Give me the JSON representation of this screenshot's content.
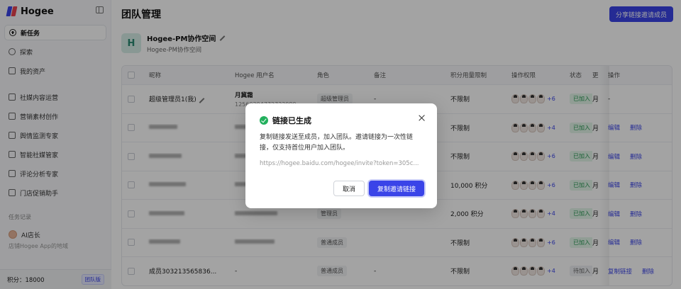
{
  "brand": "Hogee",
  "sidebar": {
    "items": [
      {
        "label": "新任务",
        "icon": "plus-circle-icon"
      },
      {
        "label": "探索",
        "icon": "compass-icon"
      },
      {
        "label": "我的资产",
        "icon": "folder-icon"
      },
      {
        "label": "社媒内容运营",
        "icon": "document-icon"
      },
      {
        "label": "营销素材创作",
        "icon": "image-icon"
      },
      {
        "label": "舆情监测专家",
        "icon": "monitor-icon"
      },
      {
        "label": "智能社媒管家",
        "icon": "document-icon"
      },
      {
        "label": "评论分析专家",
        "icon": "chat-icon"
      },
      {
        "label": "门店促销助手",
        "icon": "megaphone-icon"
      }
    ],
    "history_label": "任务记录",
    "history": [
      {
        "label": "AI店长"
      },
      {
        "label": "店铺Hogee App的地域"
      }
    ],
    "points": "积分：18000",
    "team_badge": "团队版"
  },
  "header": {
    "title": "团队管理",
    "share_button": "分享链接邀请成员"
  },
  "space": {
    "avatar_letter": "H",
    "name": "Hogee-PM协作空间",
    "subtitle": "Hogee-PM协作空间"
  },
  "table": {
    "columns": [
      "昵称",
      "Hogee 用户名",
      "角色",
      "备注",
      "积分用量限制",
      "操作权限",
      "状态",
      "更",
      "操作"
    ],
    "rows": [
      {
        "nickname": "超级管理员1(我)",
        "username": "月冀霜",
        "uid": "12560204772733089",
        "role": "超级管理员",
        "note": "-",
        "limit": "不限制",
        "plus": "+6",
        "status": "已加入",
        "tail": "月",
        "actions": [
          "-"
        ]
      },
      {
        "nickname": "",
        "username": "",
        "uid": "",
        "role": "",
        "note": "",
        "limit": "不限制",
        "plus": "+4",
        "status": "已加入",
        "tail": "月",
        "actions": [
          "编辑",
          "删除"
        ]
      },
      {
        "nickname": "",
        "username": "",
        "uid": "",
        "role": "",
        "note": "",
        "limit": "不限制",
        "plus": "+6",
        "status": "已加入",
        "tail": "月",
        "actions": [
          "编辑",
          "删除"
        ]
      },
      {
        "nickname": "",
        "username": "",
        "uid": "",
        "role": "",
        "note": "",
        "limit": "10,000 积分",
        "plus": "+6",
        "status": "已加入",
        "tail": "月",
        "actions": [
          "编辑",
          "删除"
        ]
      },
      {
        "nickname": "",
        "username": "",
        "uid": "",
        "role": "管理员",
        "note": "",
        "limit": "2,000 积分",
        "plus": "+4",
        "status": "已加入",
        "tail": "月",
        "actions": [
          "编辑",
          "删除"
        ]
      },
      {
        "nickname": "",
        "username": "",
        "uid": "",
        "role": "普通成员",
        "note": "",
        "limit": "不限制",
        "plus": "+6",
        "status": "已加入",
        "tail": "月",
        "actions": [
          "编辑",
          "删除"
        ]
      },
      {
        "nickname": "成员303213565836...",
        "username": "-",
        "uid": "",
        "role": "普通成员",
        "note": "-",
        "limit": "不限制",
        "plus": "+4",
        "status": "待加入",
        "tail": "月",
        "actions": [
          "复制链接",
          "删除"
        ]
      }
    ]
  },
  "modal": {
    "title": "链接已生成",
    "description": "复制链接发送至成员，加入团队。邀请链接为一次性链接，仅支持首位用户加入团队。",
    "link": "https://hogee.baidu.com/hogee/invite?token=305c...",
    "cancel": "取消",
    "confirm": "复制邀请链接"
  },
  "colors": {
    "accent": "#3a44e8",
    "success": "#22b05d"
  }
}
